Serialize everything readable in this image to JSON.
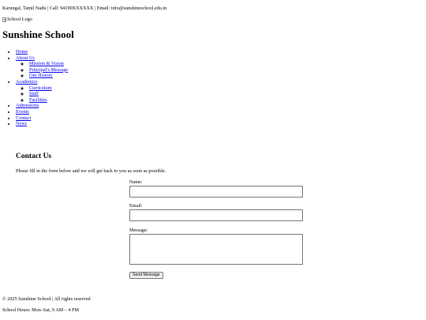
{
  "topbar": {
    "text": "Karungal, Tamil Nadu | Call: 94190XXXXXX | Email: info@sunshineschool.edu.in"
  },
  "header": {
    "logo_alt": "School Logo",
    "logo_icon": "broken-image-icon",
    "title": "Sunshine School"
  },
  "nav": {
    "home": "Home",
    "about": {
      "label": "About Us",
      "items": [
        "Mission & Vision",
        "Principal's Message",
        "Our History"
      ]
    },
    "academics": {
      "label": "Academics",
      "items": [
        "Curriculum",
        "Staff",
        "Facilities"
      ]
    },
    "admissions": "Admissions",
    "events": "Events",
    "contact": "Contact",
    "news": "News"
  },
  "contact": {
    "title": "Contact Us",
    "intro": "Please fill in the form below and we will get back to you as soon as possible.",
    "name_label": "Name:",
    "name_value": "",
    "email_label": "Email:",
    "email_value": "",
    "message_label": "Message:",
    "message_value": "",
    "submit_label": "Send Message"
  },
  "footer": {
    "copyright": "© 2025 Sunshine School | All rights reserved",
    "hours": "School Hours: Mon–Sat, 9 AM – 4 PM"
  },
  "colors": {
    "link": "#0000ee",
    "text": "#000000",
    "background": "#ffffff",
    "input_border": "#767676",
    "button_bg": "#efefef"
  }
}
